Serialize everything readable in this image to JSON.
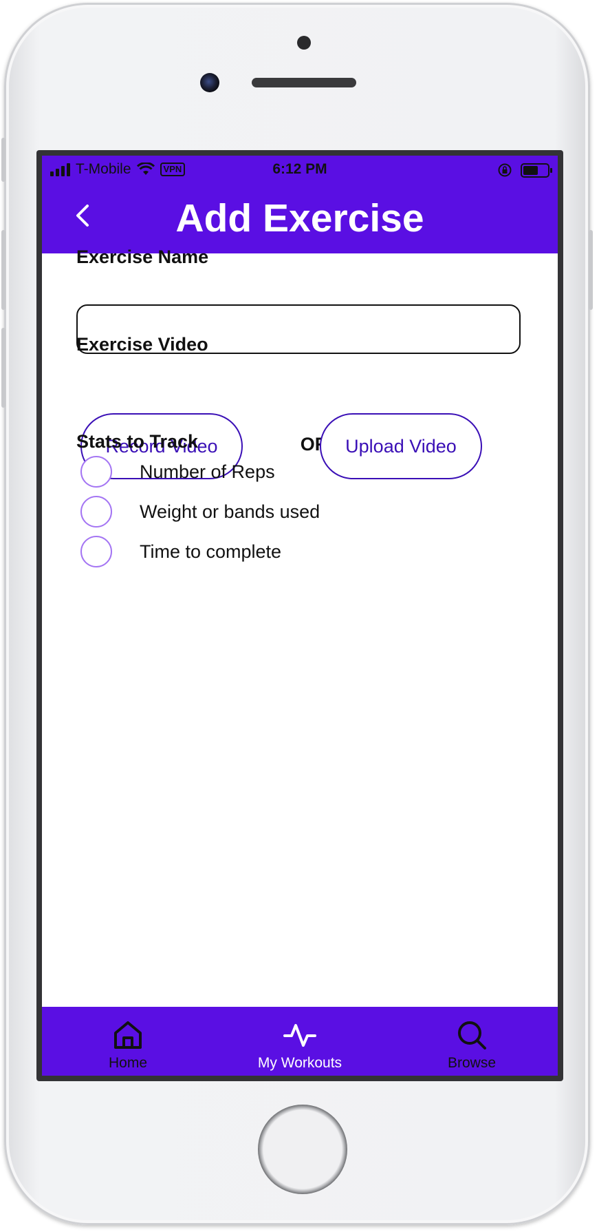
{
  "status_bar": {
    "carrier": "T-Mobile",
    "vpn": "VPN",
    "time": "6:12 PM",
    "battery_level": 0.7
  },
  "header": {
    "title": "Add Exercise",
    "back_icon": "chevron-left-icon"
  },
  "form": {
    "name_label": "Exercise Name",
    "name_value": "",
    "name_placeholder": "",
    "video_label": "Exercise Video",
    "record_label": "Record Video",
    "or_label": "OR",
    "upload_label": "Upload Video",
    "stats_label": "Stats to Track",
    "stats": [
      {
        "label": "Number of Reps",
        "selected": false
      },
      {
        "label": "Weight or bands used",
        "selected": false
      },
      {
        "label": "Time to complete",
        "selected": false
      }
    ]
  },
  "tabbar": {
    "tabs": [
      {
        "label": "Home",
        "icon": "home-icon",
        "active": false
      },
      {
        "label": "My Workouts",
        "icon": "activity-icon",
        "active": true
      },
      {
        "label": "Browse",
        "icon": "search-icon",
        "active": false
      }
    ]
  },
  "colors": {
    "accent": "#5a0fe3",
    "button_border": "#3a0fb6",
    "radio_border": "#a475f3"
  }
}
